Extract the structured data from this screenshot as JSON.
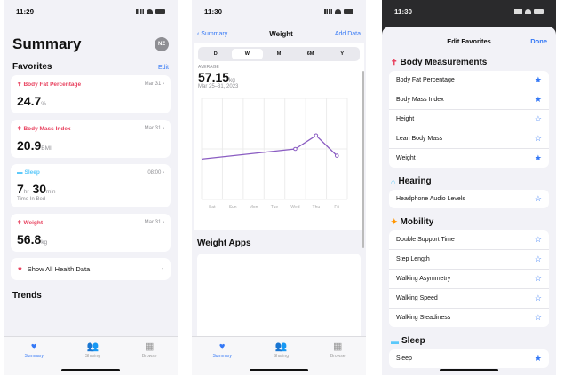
{
  "phone1": {
    "time": "11:29",
    "title": "Summary",
    "avatar": "NZ",
    "favorites_title": "Favorites",
    "edit_label": "Edit",
    "cards": [
      {
        "label": "Body Fat Percentage",
        "meta": "Mar 31",
        "value": "24.7",
        "unit": "%",
        "sub": ""
      },
      {
        "label": "Body Mass Index",
        "meta": "Mar 31",
        "value": "20.9",
        "unit": "BMI",
        "sub": ""
      },
      {
        "label": "Sleep",
        "meta": "08:00",
        "value_h": "7",
        "unit_h": "hr",
        "value_m": "30",
        "unit_m": "min",
        "sub": "Time In Bed"
      },
      {
        "label": "Weight",
        "meta": "Mar 31",
        "value": "56.8",
        "unit": "kg",
        "sub": ""
      }
    ],
    "show_all_label": "Show All Health Data",
    "trends_title": "Trends",
    "tabs": [
      {
        "label": "Summary",
        "icon": "heart-icon"
      },
      {
        "label": "Sharing",
        "icon": "people-icon"
      },
      {
        "label": "Browse",
        "icon": "grid-icon"
      }
    ]
  },
  "phone2": {
    "time": "11:30",
    "back_label": "Summary",
    "title": "Weight",
    "add_label": "Add Data",
    "segments": [
      "D",
      "W",
      "M",
      "6M",
      "Y"
    ],
    "selected_segment": "W",
    "average_label": "AVERAGE",
    "average_value": "57.15",
    "average_unit": "kg",
    "date_range": "Mar 25–31, 2023",
    "apps_title": "Weight Apps"
  },
  "phone3": {
    "time": "11:30",
    "sheet_title": "Edit Favorites",
    "done_label": "Done",
    "categories": [
      {
        "title": "Body Measurements",
        "icon": "figure-icon",
        "items": [
          {
            "label": "Body Fat Percentage",
            "starred": true
          },
          {
            "label": "Body Mass Index",
            "starred": true
          },
          {
            "label": "Height",
            "starred": false
          },
          {
            "label": "Lean Body Mass",
            "starred": false
          },
          {
            "label": "Weight",
            "starred": true
          }
        ]
      },
      {
        "title": "Hearing",
        "icon": "ear-icon",
        "items": [
          {
            "label": "Headphone Audio Levels",
            "starred": false
          }
        ]
      },
      {
        "title": "Mobility",
        "icon": "mobility-icon",
        "items": [
          {
            "label": "Double Support Time",
            "starred": false
          },
          {
            "label": "Step Length",
            "starred": false
          },
          {
            "label": "Walking Asymmetry",
            "starred": false
          },
          {
            "label": "Walking Speed",
            "starred": false
          },
          {
            "label": "Walking Steadiness",
            "starred": false
          }
        ]
      },
      {
        "title": "Sleep",
        "icon": "bed-icon",
        "items": [
          {
            "label": "Sleep",
            "starred": true
          }
        ]
      }
    ]
  },
  "chart_data": {
    "type": "line",
    "categories": [
      "Sat",
      "Sun",
      "Mon",
      "Tue",
      "Wed",
      "Thu",
      "Fri"
    ],
    "values": [
      null,
      null,
      null,
      null,
      57.0,
      57.4,
      56.8
    ],
    "line_start_estimate": 56.7,
    "accent": "#8a5cc2"
  }
}
